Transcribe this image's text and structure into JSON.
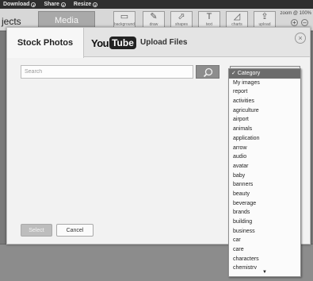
{
  "topbar": {
    "menus": [
      {
        "label": "Download"
      },
      {
        "label": "Share"
      },
      {
        "label": "Resize"
      }
    ]
  },
  "toolbar": {
    "projects_label": "jects",
    "media_tab_label": "Media",
    "tools": [
      {
        "icon": "background-icon",
        "label": "background"
      },
      {
        "icon": "draw-icon",
        "label": "draw"
      },
      {
        "icon": "shapes-icon",
        "label": "shapes"
      },
      {
        "icon": "text-icon",
        "label": "text"
      },
      {
        "icon": "charts-icon",
        "label": "charts"
      },
      {
        "icon": "upload-icon",
        "label": "upload"
      }
    ],
    "zoom_label": "zoom @ 100%",
    "zoom_in": "+",
    "zoom_out": "–"
  },
  "modal": {
    "tabs": {
      "stock_photos": "Stock Photos",
      "youtube_you": "You",
      "youtube_tube": "Tube",
      "upload_files": "Upload Files"
    },
    "close_symbol": "×",
    "search": {
      "placeholder": "Search",
      "value": ""
    },
    "category_selected": "Category",
    "buttons": {
      "select": "Select",
      "cancel": "Cancel"
    }
  },
  "dropdown": {
    "items": [
      "✓ Category",
      "My images",
      "report",
      "activities",
      "agriculture",
      "airport",
      "animals",
      "application",
      "arrow",
      "audio",
      "avatar",
      "baby",
      "banners",
      "beauty",
      "beverage",
      "brands",
      "building",
      "business",
      "car",
      "care",
      "characters",
      "chemistry"
    ],
    "scroll_arrow": "▼"
  }
}
